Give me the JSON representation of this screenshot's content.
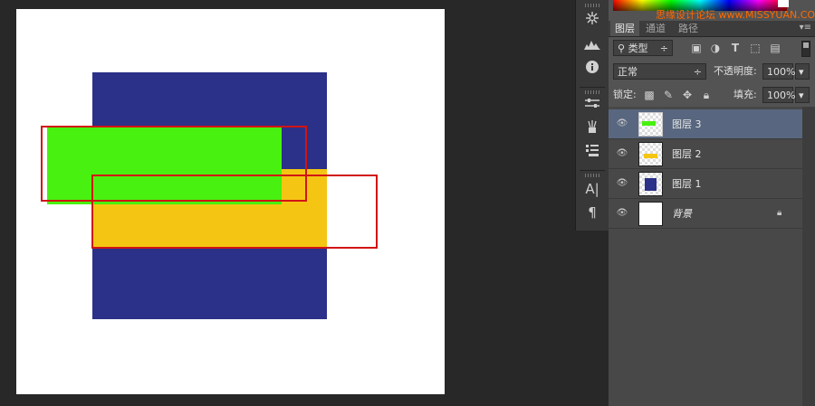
{
  "panel": {
    "watermark": "思缘设计论坛 www.MISSYUAN.COM",
    "tabs": [
      {
        "label": "图层",
        "active": true
      },
      {
        "label": "通道",
        "active": false
      },
      {
        "label": "路径",
        "active": false
      }
    ],
    "filter": {
      "label": "类型",
      "arrow": "÷"
    },
    "blend_mode": {
      "value": "正常",
      "arrow": "÷"
    },
    "opacity": {
      "label": "不透明度:",
      "value": "100%"
    },
    "lock": {
      "label": "锁定:"
    },
    "fill": {
      "label": "填充:",
      "value": "100%"
    },
    "dropdown_arrow": "▾",
    "menu_icon": "▾≡"
  },
  "layers": [
    {
      "name": "图层 3",
      "selected": true,
      "thumb_color": "#48f10f"
    },
    {
      "name": "图层 2",
      "selected": false,
      "thumb_color": "#f4c613"
    },
    {
      "name": "图层 1",
      "selected": false,
      "thumb_color": "#2b3089"
    },
    {
      "name": "背景",
      "selected": false,
      "thumb_color": "#ffffff",
      "locked": true
    }
  ],
  "canvas": {
    "shape_colors": {
      "blue": "#2b3089",
      "yellow": "#f4c613",
      "green": "#48f10f",
      "selection": "#d11414"
    }
  },
  "tools": [
    "snowflake-icon",
    "histogram-icon",
    "info-icon",
    "adjust-icon",
    "brushes-icon",
    "clone-icon",
    "character-icon",
    "paragraph-icon"
  ],
  "tool_glyphs": {
    "character": "A|",
    "paragraph": "¶"
  }
}
